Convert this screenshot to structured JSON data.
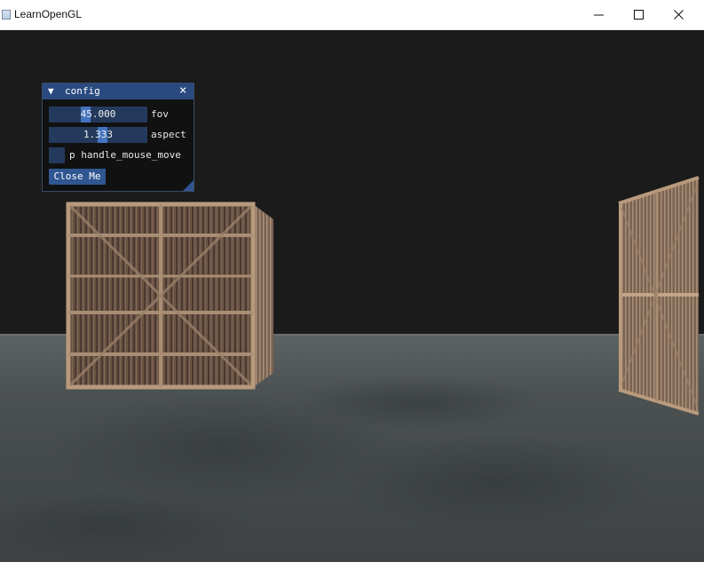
{
  "window": {
    "title": "LearnOpenGL",
    "buttons": [
      "minimize",
      "maximize",
      "close"
    ]
  },
  "config_panel": {
    "title": "config",
    "collapse_icon": "triangle-down-icon",
    "close_icon": "close-icon",
    "fov": {
      "value": "45.000",
      "label": "fov"
    },
    "aspect": {
      "value": "1.333",
      "label": "aspect"
    },
    "handle_mouse_move": {
      "checked": false,
      "label": "p handle_mouse_move"
    },
    "close_button": "Close Me"
  },
  "colors": {
    "title_bar_active": "#2a4a80",
    "frame_bg": "#243a5c",
    "button": "#2f5691",
    "text_selection": "#4a7fd0"
  }
}
